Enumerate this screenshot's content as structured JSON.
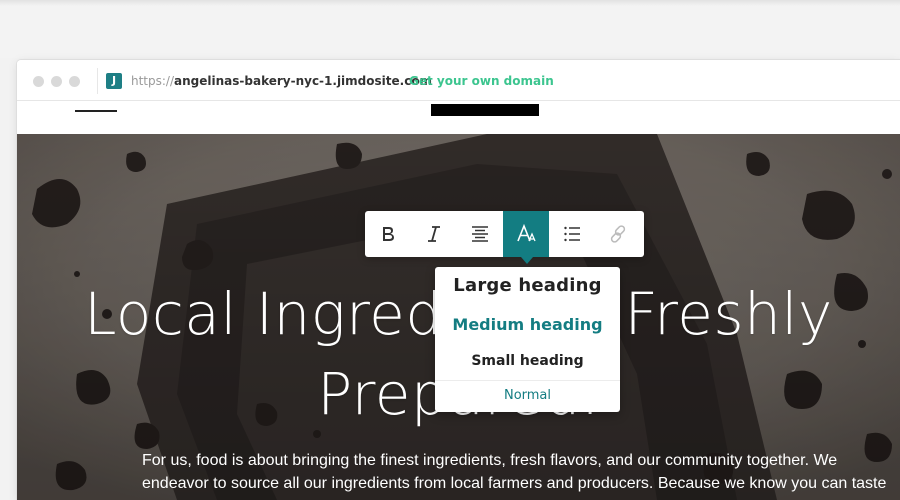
{
  "browser": {
    "url_scheme": "https://",
    "url_host": "angelinas-bakery-nyc-1.jimdosite.com",
    "domain_link": "Get your own domain",
    "site_logo_letter": "J"
  },
  "hero": {
    "heading_line1": "Local Ingredients. Freshly",
    "heading_line2": "Prepared.",
    "body_line1": "For us, food is about bringing the finest ingredients, fresh flavors, and our community together. We",
    "body_line2": "endeavor to source all our ingredients from local farmers and producers. Because we know you can taste"
  },
  "toolbar": {
    "buttons": [
      {
        "name": "bold-button",
        "icon": "bold-icon"
      },
      {
        "name": "italic-button",
        "icon": "italic-icon"
      },
      {
        "name": "align-center-button",
        "icon": "align-center-icon"
      },
      {
        "name": "text-style-button",
        "icon": "font-icon",
        "active": true
      },
      {
        "name": "list-button",
        "icon": "list-icon"
      },
      {
        "name": "link-button",
        "icon": "link-icon",
        "disabled": true
      }
    ],
    "accent_color": "#137d82"
  },
  "dropdown": {
    "large": "Large heading",
    "medium": "Medium heading",
    "small": "Small heading",
    "normal": "Normal",
    "selected": "Medium heading"
  },
  "colors": {
    "accent": "#137d82",
    "domain_link": "#3cc58f"
  }
}
